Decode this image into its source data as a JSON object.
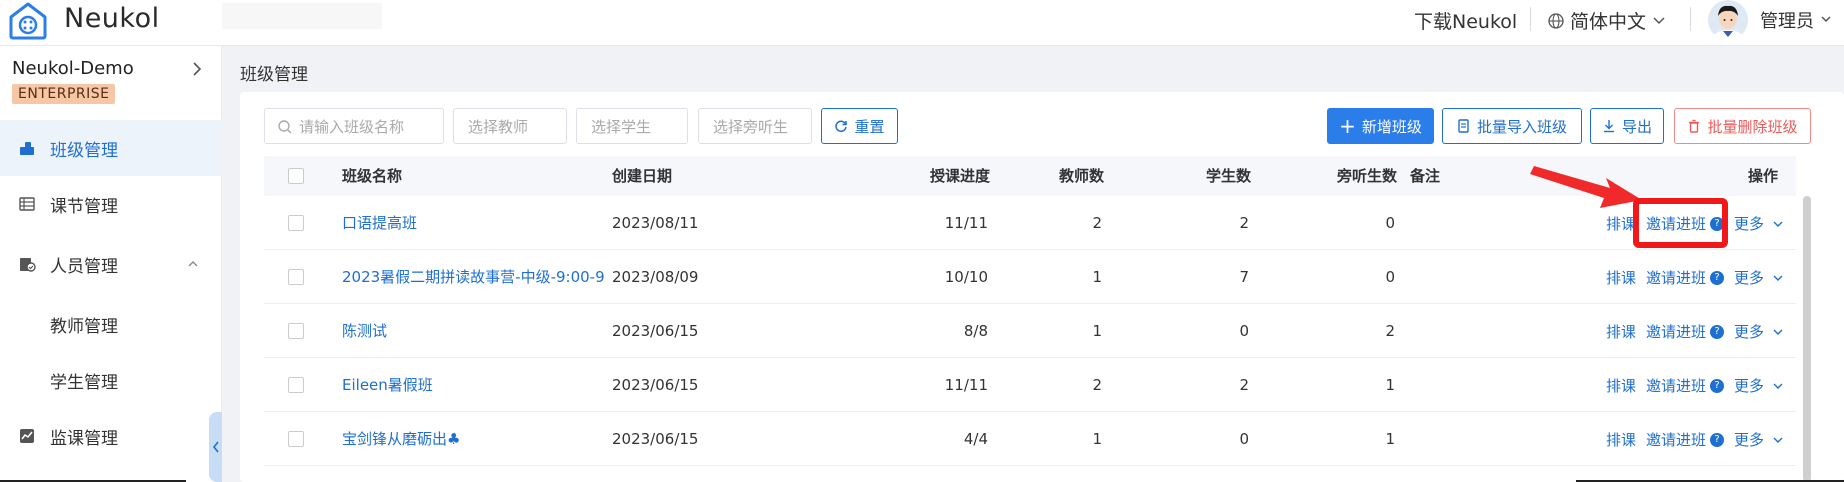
{
  "header": {
    "brand": "Neukol",
    "download": "下载Neukol",
    "language": "简体中文",
    "user": "管理员"
  },
  "sidebar": {
    "org_name": "Neukol-Demo",
    "badge": "ENTERPRISE",
    "items": [
      {
        "label": "班级管理",
        "icon": "class-icon",
        "active": true
      },
      {
        "label": "课节管理",
        "icon": "list-icon"
      },
      {
        "label": "人员管理",
        "icon": "people-icon",
        "expanded": true
      },
      {
        "label": "教师管理"
      },
      {
        "label": "学生管理"
      },
      {
        "label": "监课管理",
        "icon": "monitor-icon"
      }
    ]
  },
  "page": {
    "title": "班级管理"
  },
  "filters": {
    "class_name_placeholder": "请输入班级名称",
    "teacher_placeholder": "选择教师",
    "student_placeholder": "选择学生",
    "auditor_placeholder": "选择旁听生",
    "reset": "重置"
  },
  "actions": {
    "add": "新增班级",
    "import": "批量导入班级",
    "export": "导出",
    "batch_delete": "批量删除班级"
  },
  "table": {
    "headers": {
      "name": "班级名称",
      "created": "创建日期",
      "progress": "授课进度",
      "teachers": "教师数",
      "students": "学生数",
      "auditors": "旁听生数",
      "note": "备注",
      "ops": "操作"
    },
    "op_labels": {
      "schedule": "排课",
      "invite": "邀请进班",
      "more": "更多"
    },
    "rows": [
      {
        "name": "口语提高班",
        "created": "2023/08/11",
        "progress": "11/11",
        "teachers": "2",
        "students": "2",
        "auditors": "0"
      },
      {
        "name": "2023暑假二期拼读故事营-中级-9:00-9",
        "created": "2023/08/09",
        "progress": "10/10",
        "teachers": "1",
        "students": "7",
        "auditors": "0"
      },
      {
        "name": "陈测试",
        "created": "2023/06/15",
        "progress": "8/8",
        "teachers": "1",
        "students": "0",
        "auditors": "2"
      },
      {
        "name": "Eileen暑假班",
        "created": "2023/06/15",
        "progress": "11/11",
        "teachers": "2",
        "students": "2",
        "auditors": "1"
      },
      {
        "name": "宝剑锋从磨砺出♣",
        "created": "2023/06/15",
        "progress": "4/4",
        "teachers": "1",
        "students": "0",
        "auditors": "1"
      }
    ]
  },
  "colors": {
    "primary": "#2b7de9",
    "link": "#1f6fd1",
    "danger": "#f05a5a",
    "highlight": "#f01818"
  }
}
